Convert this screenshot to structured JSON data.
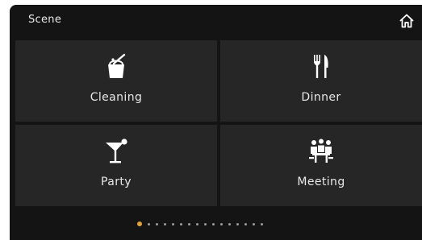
{
  "header": {
    "title": "Scene",
    "home_icon": "home-icon"
  },
  "scenes": [
    {
      "label": "Cleaning",
      "icon": "cleaning-bucket-icon"
    },
    {
      "label": "Dinner",
      "icon": "fork-knife-icon"
    },
    {
      "label": "Party",
      "icon": "cocktail-glass-icon"
    },
    {
      "label": "Meeting",
      "icon": "meeting-people-icon"
    }
  ],
  "pager": {
    "total_pages": 16,
    "current_page": 1
  },
  "colors": {
    "background": "#141414",
    "tile": "#262626",
    "text": "#e8e8e8",
    "active_dot": "#e0a23a",
    "inactive_dot": "#9a9a9a"
  }
}
